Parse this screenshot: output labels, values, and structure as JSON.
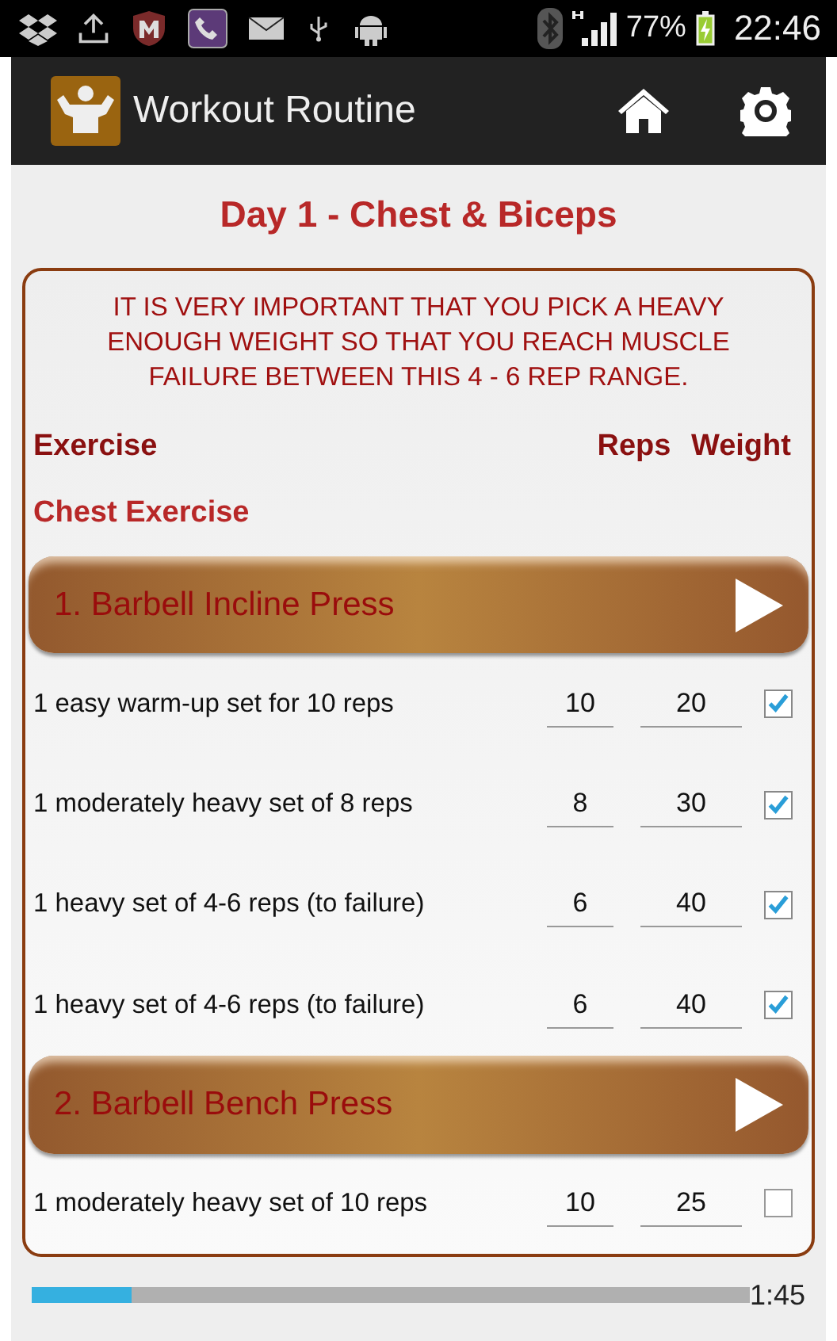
{
  "status_bar": {
    "battery": "77%",
    "time": "22:46"
  },
  "app_bar": {
    "title": "Workout Routine"
  },
  "day_title": "Day 1 - Chest & Biceps",
  "notice": "IT IS VERY IMPORTANT THAT YOU PICK A HEAVY ENOUGH WEIGHT SO THAT YOU REACH MUSCLE FAILURE BETWEEN THIS 4 - 6 REP RANGE.",
  "columns": [
    "Exercise",
    "Reps",
    "Weight"
  ],
  "section": "Chest Exercise",
  "exercises": [
    {
      "title": "1. Barbell Incline Press",
      "sets": [
        {
          "label": "1 easy warm-up set for 10 reps",
          "reps": "10",
          "weight": "20",
          "checked": true
        },
        {
          "label": "1 moderately heavy set of 8 reps",
          "reps": "8",
          "weight": "30",
          "checked": true
        },
        {
          "label": "1 heavy set of 4-6 reps (to failure)",
          "reps": "6",
          "weight": "40",
          "checked": true
        },
        {
          "label": "1 heavy set of 4-6 reps (to failure)",
          "reps": "6",
          "weight": "40",
          "checked": true
        }
      ]
    },
    {
      "title": "2. Barbell Bench Press",
      "sets": [
        {
          "label": "1 moderately heavy set of 10 reps",
          "reps": "10",
          "weight": "25",
          "checked": false
        }
      ]
    }
  ],
  "timer": {
    "level": 0.14,
    "time": "1:45"
  }
}
